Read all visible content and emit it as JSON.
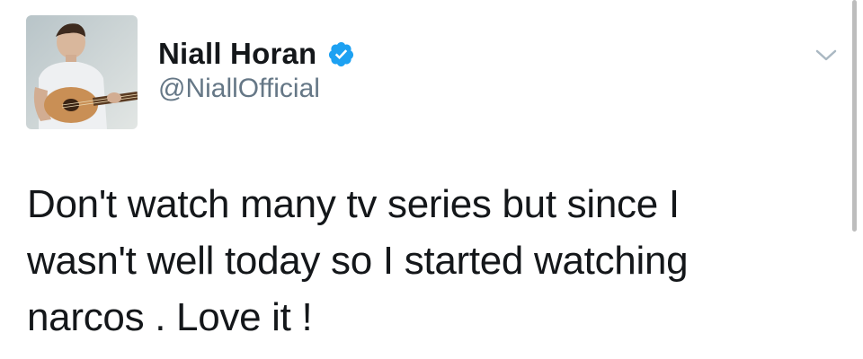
{
  "tweet": {
    "author": {
      "display_name": "Niall Horan",
      "handle": "@NiallOfficial",
      "verified": true
    },
    "text": "Don't watch many tv series but since I\nwasn't well today so I started watching\nnarcos . Love it !"
  },
  "icons": {
    "verified": "verified-badge-icon",
    "menu": "chevron-down-icon"
  },
  "colors": {
    "verified_blue": "#1da1f2",
    "handle_gray": "#657786",
    "text": "#14171a"
  }
}
